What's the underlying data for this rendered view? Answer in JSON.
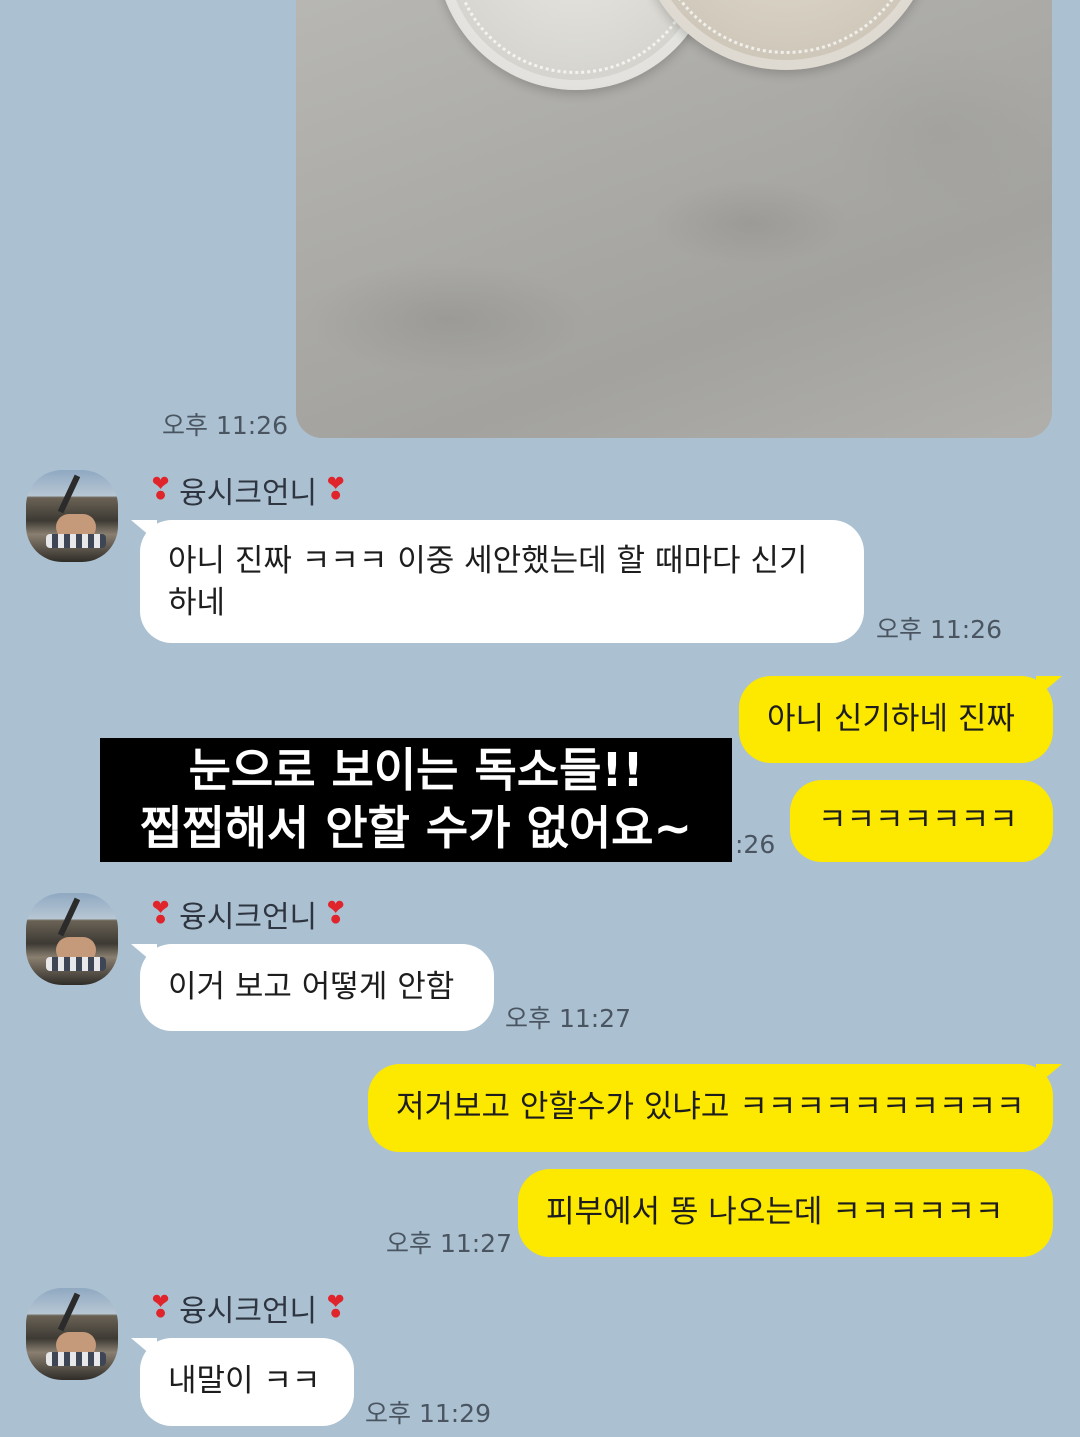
{
  "photo_message": {
    "time": "오후 11:26"
  },
  "messages": [
    {
      "sender": "융시크언니",
      "text_lines": [
        "아니 진짜 ㅋㅋㅋ 이중 세안했는데 할 때마다 신기",
        "하네"
      ],
      "time": "오후 11:26"
    },
    {
      "sender": "me",
      "bubbles": [
        "아니 신기하네 진짜",
        "ㅋㅋㅋㅋㅋㅋㅋ"
      ],
      "time_partial": ":26"
    },
    {
      "sender": "융시크언니",
      "text": "이거 보고 어떻게 안함",
      "time": "오후 11:27"
    },
    {
      "sender": "me",
      "bubbles": [
        "저거보고 안할수가 있냐고 ㅋㅋㅋㅋㅋㅋㅋㅋㅋㅋ",
        "피부에서 똥 나오는데 ㅋㅋㅋㅋㅋㅋ"
      ],
      "time": "오후 11:27"
    },
    {
      "sender": "융시크언니",
      "text": "내말이 ㅋㅋ",
      "time": "오후 11:29"
    }
  ],
  "caption": {
    "line1": "눈으로 보이는 독소들!!",
    "line2": "찝찝해서 안할 수가 없어요~"
  },
  "heart_glyph": "❣",
  "colors": {
    "background": "#abc1d1",
    "my_bubble": "#fde800",
    "their_bubble": "#ffffff",
    "heart": "#e0242b"
  }
}
